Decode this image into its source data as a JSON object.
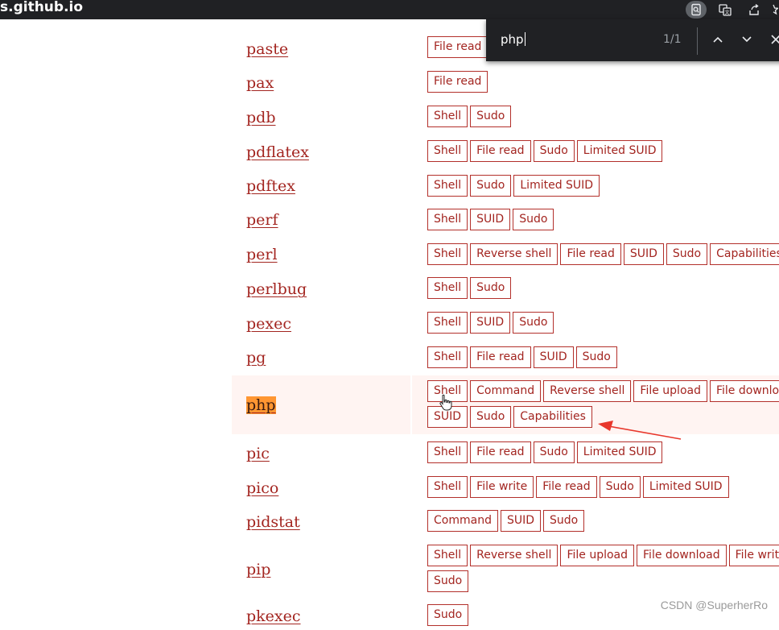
{
  "browser": {
    "url_fragment": "s.github.io",
    "icons": [
      "find-icon",
      "translate-icon",
      "share-icon",
      "bookmark-star-icon"
    ]
  },
  "find_bar": {
    "query": "php",
    "match_count": "1/1",
    "icons": [
      "chevron-up-icon",
      "chevron-down-icon",
      "close-icon"
    ]
  },
  "rows": [
    {
      "name": "paste",
      "functions": [
        [
          "File read"
        ]
      ]
    },
    {
      "name": "pax",
      "functions": [
        [
          "File read"
        ]
      ]
    },
    {
      "name": "pdb",
      "functions": [
        [
          "Shell",
          "Sudo"
        ]
      ]
    },
    {
      "name": "pdflatex",
      "functions": [
        [
          "Shell",
          "File read",
          "Sudo",
          "Limited SUID"
        ]
      ]
    },
    {
      "name": "pdftex",
      "functions": [
        [
          "Shell",
          "Sudo",
          "Limited SUID"
        ]
      ]
    },
    {
      "name": "perf",
      "functions": [
        [
          "Shell",
          "SUID",
          "Sudo"
        ]
      ]
    },
    {
      "name": "perl",
      "functions": [
        [
          "Shell",
          "Reverse shell",
          "File read",
          "SUID",
          "Sudo",
          "Capabilities"
        ]
      ]
    },
    {
      "name": "perlbug",
      "functions": [
        [
          "Shell",
          "Sudo"
        ]
      ]
    },
    {
      "name": "pexec",
      "functions": [
        [
          "Shell",
          "SUID",
          "Sudo"
        ]
      ]
    },
    {
      "name": "pg",
      "functions": [
        [
          "Shell",
          "File read",
          "SUID",
          "Sudo"
        ]
      ]
    },
    {
      "name": "php",
      "highlighted": true,
      "functions": [
        [
          "Shell",
          "Command",
          "Reverse shell",
          "File upload",
          "File download"
        ],
        [
          "SUID",
          "Sudo",
          "Capabilities"
        ]
      ]
    },
    {
      "name": "pic",
      "functions": [
        [
          "Shell",
          "File read",
          "Sudo",
          "Limited SUID"
        ]
      ]
    },
    {
      "name": "pico",
      "functions": [
        [
          "Shell",
          "File write",
          "File read",
          "Sudo",
          "Limited SUID"
        ]
      ]
    },
    {
      "name": "pidstat",
      "functions": [
        [
          "Command",
          "SUID",
          "Sudo"
        ]
      ]
    },
    {
      "name": "pip",
      "functions": [
        [
          "Shell",
          "Reverse shell",
          "File upload",
          "File download",
          "File write"
        ],
        [
          "Sudo"
        ]
      ]
    },
    {
      "name": "pkexec",
      "functions": [
        [
          "Sudo"
        ]
      ]
    }
  ],
  "colors": {
    "link": "#a32520",
    "tag_border": "#b3302b",
    "highlight_row": "#fff4f2",
    "find_match": "#ff9632",
    "annotation_arrow": "#e8372c"
  },
  "watermark": "CSDN @SuperherRo"
}
